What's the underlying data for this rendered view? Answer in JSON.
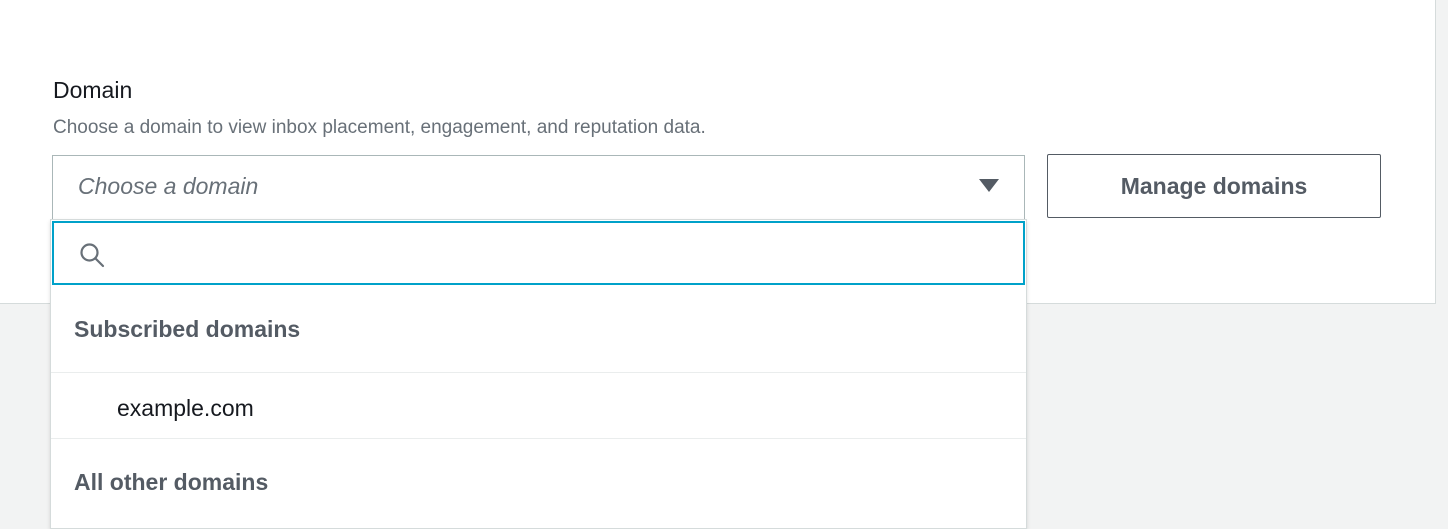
{
  "field": {
    "label": "Domain",
    "description": "Choose a domain to view inbox placement, engagement, and reputation data."
  },
  "select": {
    "placeholder": "Choose a domain",
    "caret_icon": "caret-down-icon"
  },
  "manage_button": {
    "label": "Manage domains"
  },
  "dropdown": {
    "search": {
      "icon": "search-icon",
      "value": "",
      "focus_color": "#00a1c9"
    },
    "groups": [
      {
        "label": "Subscribed domains",
        "items": [
          "example.com"
        ]
      },
      {
        "label": "All other domains",
        "items": []
      }
    ]
  }
}
